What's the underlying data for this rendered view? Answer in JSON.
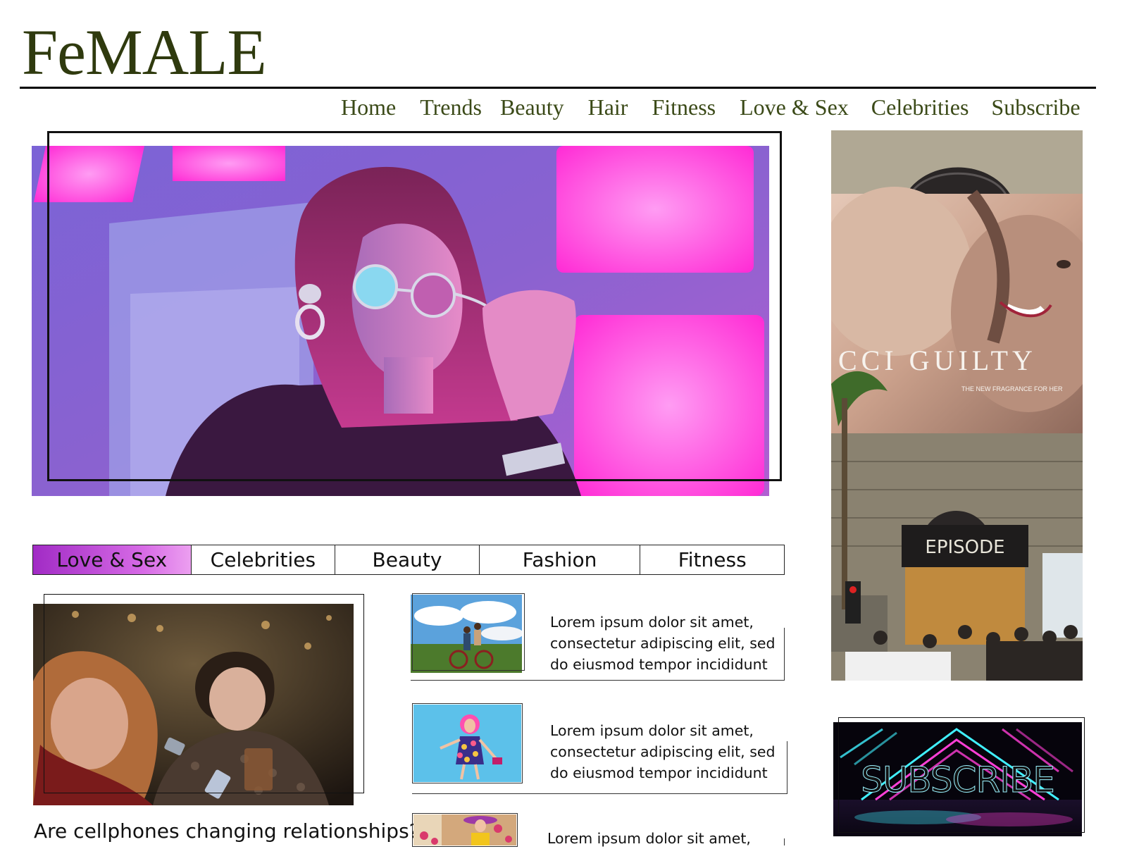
{
  "brand": {
    "logo": "FeMALE"
  },
  "nav": {
    "items": [
      "Home",
      "Trends",
      "Beauty",
      "Hair",
      "Fitness",
      "Love & Sex",
      "Celebrities",
      "Subscribe"
    ]
  },
  "hero": {
    "image": "woman-neon-sunglasses-photo"
  },
  "side_ad": {
    "billboard_text": "CCI GUILTY",
    "billboard_subtext": "THE NEW FRAGRANCE FOR HER",
    "store_sign": "EPISODE"
  },
  "category_tabs": {
    "items": [
      "Love & Sex",
      "Celebrities",
      "Beauty",
      "Fashion",
      "Fitness"
    ],
    "active": "Love & Sex"
  },
  "feature": {
    "caption": "Are cellphones changing relationships?"
  },
  "articles": [
    {
      "line1": "Lorem ipsum dolor sit amet,",
      "line2": "consectetur adipiscing elit, sed",
      "line3": "do eiusmod tempor incididunt",
      "thumb": "couple-on-bicycle-photo"
    },
    {
      "line1": "Lorem ipsum dolor sit amet,",
      "line2": "consectetur adipiscing elit, sed",
      "line3": "do eiusmod tempor incididunt",
      "thumb": "woman-pink-hair-dress-photo"
    },
    {
      "line1": "Lorem ipsum dolor sit amet,",
      "line2": "",
      "line3": "",
      "thumb": "woman-yellow-coat-flowers-photo"
    }
  ],
  "subscribe_banner": {
    "label": "SUBSCRIBE"
  },
  "colors": {
    "logo": "#2f3a0e",
    "nav": "#3b4a18",
    "active_tab": "#b03ad0",
    "neon_pink": "#ff3fd6",
    "neon_cyan": "#40f0ff"
  }
}
